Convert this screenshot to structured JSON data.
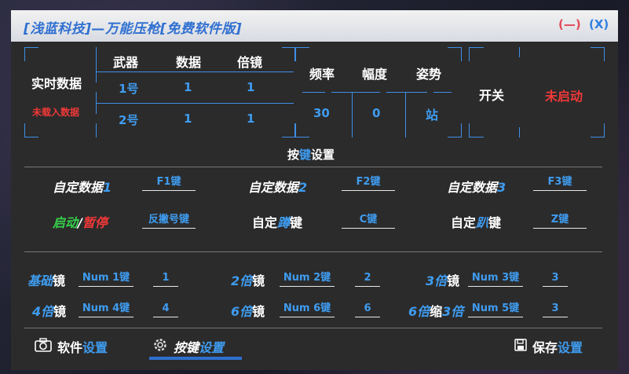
{
  "window": {
    "title": "[浅蓝科技]—万能压枪[免费软件版]",
    "min_label": "(—)",
    "close_label": "(X)"
  },
  "realtime": {
    "label": "实时数据",
    "status": "未载入数据",
    "headers": [
      "武器",
      "数据",
      "倍镜"
    ],
    "rows": [
      {
        "weapon": "1号",
        "data": "1",
        "scope": "1"
      },
      {
        "weapon": "2号",
        "data": "1",
        "scope": "1"
      }
    ]
  },
  "freq": {
    "headers": [
      "频率",
      "幅度",
      "姿势"
    ],
    "values": [
      "30",
      "0",
      "站"
    ]
  },
  "switch": {
    "label": "开关",
    "status": "未启动"
  },
  "keyset": {
    "title_a": "按",
    "title_b": "键",
    "title_c": "设置",
    "custom1": {
      "a": "自定数据",
      "b": "1",
      "key": "F1键"
    },
    "custom2": {
      "a": "自定数据",
      "b": "2",
      "key": "F2键"
    },
    "custom3": {
      "a": "自定数据",
      "b": "3",
      "key": "F3键"
    },
    "startpause": {
      "start": "启动",
      "slash": "/",
      "pause": "暂停",
      "key": "反撇号键"
    },
    "crouch": {
      "a": "自定",
      "b": "蹲",
      "c": "键",
      "key": "C键"
    },
    "prone": {
      "a": "自定",
      "b": "趴",
      "c": "键",
      "key": "Z键"
    }
  },
  "scopes": [
    {
      "a": "基础",
      "b": "镜",
      "key": "Num 1键",
      "value": "1"
    },
    {
      "a": "2倍",
      "b": "镜",
      "key": "Num 2键",
      "value": "2"
    },
    {
      "a": "3倍",
      "b": "镜",
      "key": "Num 3键",
      "value": "3"
    },
    {
      "a": "4倍",
      "b": "镜",
      "key": "Num 4键",
      "value": "4"
    },
    {
      "a": "6倍",
      "b": "镜",
      "key": "Num 6键",
      "value": "6"
    },
    {
      "a": "6倍",
      "b": "缩",
      "c": "3倍",
      "key": "Num 5键",
      "value": "3"
    }
  ],
  "tabs": {
    "software": {
      "a": "软件",
      "b": "设置"
    },
    "keys": {
      "a": "按键",
      "b": "设置"
    },
    "save": {
      "a": "保存",
      "b": "设置"
    }
  },
  "colors": {
    "accent": "#3f9cf0",
    "alert": "#f03838",
    "start": "#35d24b",
    "panel": "#2b2b2b"
  }
}
